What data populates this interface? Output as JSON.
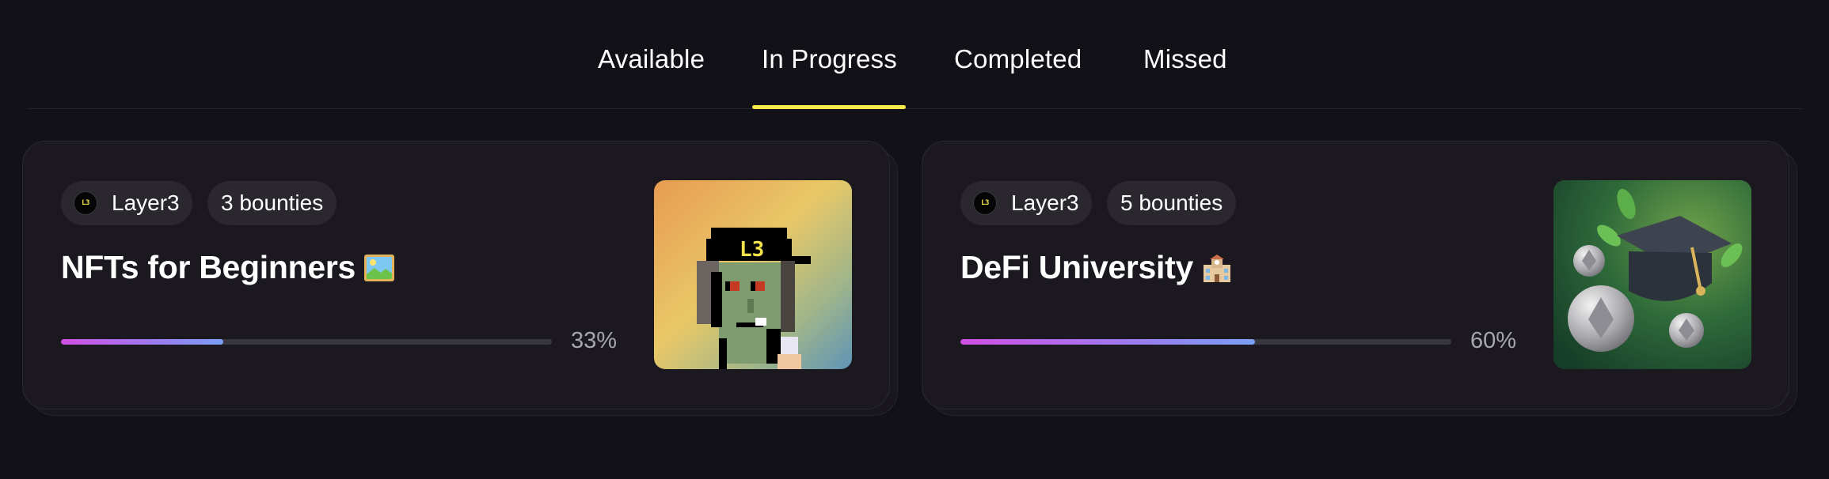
{
  "tabs": [
    {
      "label": "Available",
      "active": false
    },
    {
      "label": "In Progress",
      "active": true
    },
    {
      "label": "Completed",
      "active": false
    },
    {
      "label": "Missed",
      "active": false
    }
  ],
  "accent_color": "#f6e94b",
  "progress_gradient": [
    "#d050e4",
    "#7aa0f5"
  ],
  "cards": [
    {
      "org": "Layer3",
      "org_logo_text": "L3",
      "bounties": "3 bounties",
      "title": "NFTs for Beginners",
      "title_emoji": "framed-picture-icon",
      "progress": 33,
      "progress_label": "33%",
      "image": "pixel-punk-avatar-with-L3-cap"
    },
    {
      "org": "Layer3",
      "org_logo_text": "L3",
      "bounties": "5 bounties",
      "title": "DeFi University",
      "title_emoji": "school-icon",
      "progress": 60,
      "progress_label": "60%",
      "image": "graduation-cap-with-coins"
    }
  ]
}
